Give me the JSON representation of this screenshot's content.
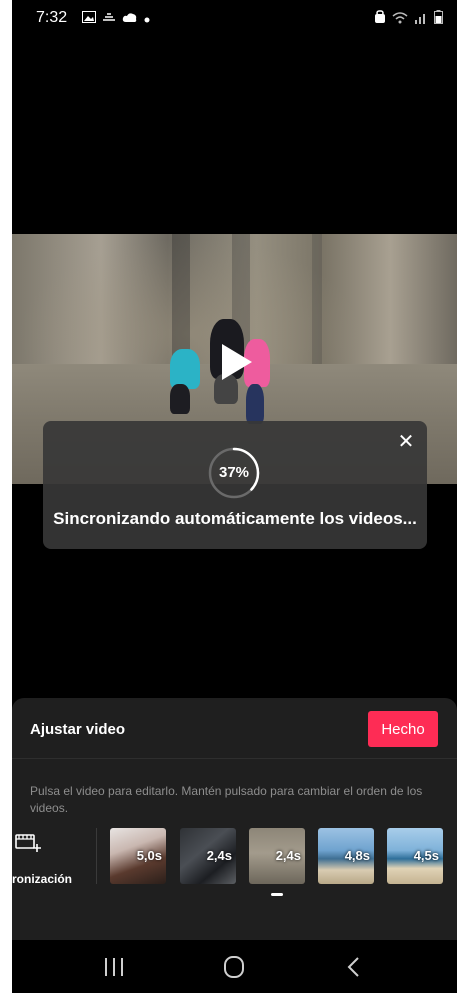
{
  "status_bar": {
    "time": "7:32",
    "left_icons": [
      "gallery-icon",
      "weather-icon",
      "cloud-icon",
      "dot-icon"
    ],
    "right_icons": [
      "alarm-icon",
      "wifi-icon",
      "signal-icon",
      "battery-icon"
    ]
  },
  "video": {
    "play_icon": "play-icon"
  },
  "progress": {
    "percent_label": "37%",
    "percent": 37,
    "message": "Sincronizando automáticamente los videos...",
    "close_icon": "close-icon"
  },
  "sheet": {
    "title": "Ajustar video",
    "done_label": "Hecho",
    "hint": "Pulsa el video para editarlo. Mantén pulsado para cambiar el orden de los videos.",
    "sync_label": "ncronización",
    "clips": [
      {
        "duration": "5,0s"
      },
      {
        "duration": "2,4s"
      },
      {
        "duration": "2,4s"
      },
      {
        "duration": "4,8s"
      },
      {
        "duration": "4,5s"
      }
    ]
  },
  "nav": {
    "items": [
      "recents-icon",
      "home-icon",
      "back-icon"
    ]
  },
  "colors": {
    "accent": "#fe2c55",
    "background": "#000000",
    "sheet": "#1f1f1f"
  }
}
